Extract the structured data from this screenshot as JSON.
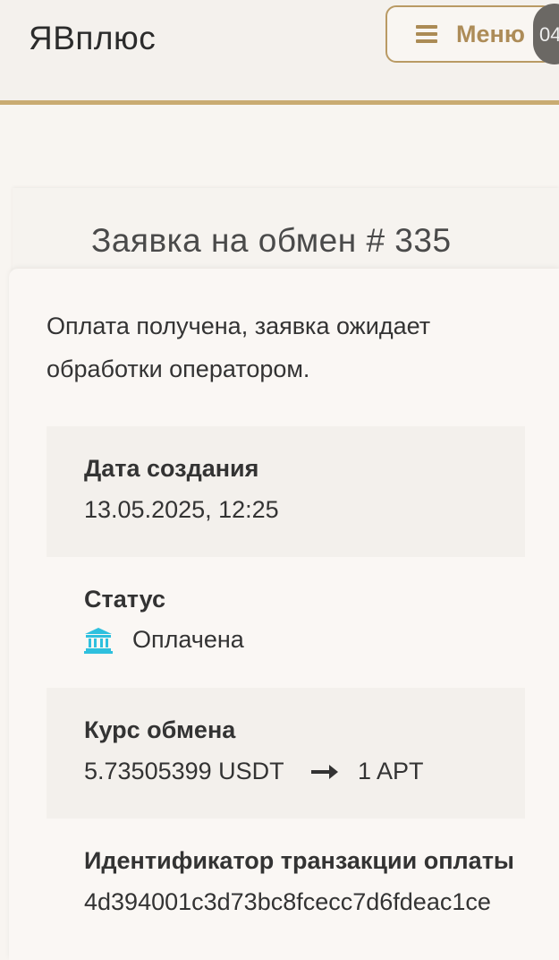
{
  "header": {
    "brand": "ЯВплюс",
    "menu_label": "Меню",
    "overlay_badge": "04"
  },
  "order": {
    "title": "Заявка на обмен # 335",
    "status_message": "Оплата получена, заявка ожидает обработки оператором.",
    "created_label": "Дата создания",
    "created_value": "13.05.2025, 12:25",
    "status_label": "Статус",
    "status_value": "Оплачена",
    "status_icon": "bank-icon",
    "rate_label": "Курс обмена",
    "rate_from": "5.73505399 USDT",
    "rate_to": "1 APT",
    "tx_label": "Идентификатор транзакции оплаты",
    "tx_value": "4d394001c3d73bc8fcecc7d6fdeac1ce"
  },
  "colors": {
    "accent": "#c9ab72",
    "menu_text": "#ad8c58",
    "status_icon": "#2ec0de"
  }
}
